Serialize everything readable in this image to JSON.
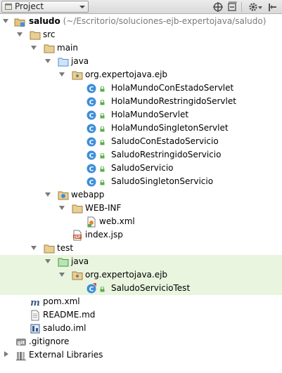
{
  "header": {
    "view_selector": "Project",
    "icons": [
      "scroll-from-source-icon",
      "collapse-all-icon",
      "gear-icon",
      "hide-icon"
    ]
  },
  "tree": {
    "root": {
      "name": "saludo",
      "path": "(~/Escritorio/soluciones-ejb-expertojava/saludo)"
    },
    "src": "src",
    "main": "main",
    "java_main": "java",
    "package_main": "org.expertojava.ejb",
    "classes": [
      "HolaMundoConEstadoServlet",
      "HolaMundoRestringidoServlet",
      "HolaMundoServlet",
      "HolaMundoSingletonServlet",
      "SaludoConEstadoServicio",
      "SaludoRestringidoServicio",
      "SaludoServicio",
      "SaludoSingletonServicio"
    ],
    "webapp": "webapp",
    "webinf": "WEB-INF",
    "webxml": "web.xml",
    "indexjsp": "index.jsp",
    "test": "test",
    "java_test": "java",
    "package_test": "org.expertojava.ejb",
    "test_class": "SaludoServicioTest",
    "pom": "pom.xml",
    "readme": "README.md",
    "iml": "saludo.iml",
    "gitignore": ".gitignore",
    "external": "External Libraries"
  },
  "colors": {
    "folder": "#c9a15a",
    "source_folder": "#4a8fd6",
    "test_folder": "#3e9a3e",
    "class_badge": "#3d8fd8",
    "highlight": "#e9f5df"
  }
}
